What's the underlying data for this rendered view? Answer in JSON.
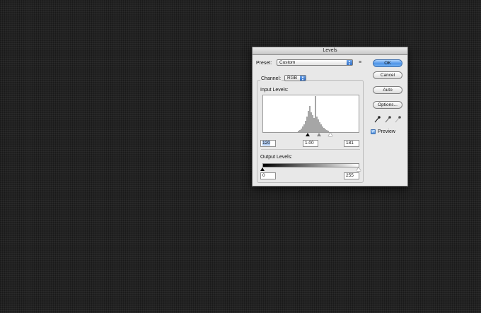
{
  "dialog": {
    "title": "Levels",
    "preset": {
      "label": "Preset:",
      "value": "Custom"
    },
    "channel": {
      "label": "Channel:",
      "value": "RGB"
    },
    "input_levels": {
      "label": "Input Levels:",
      "black": "120",
      "gamma": "1.00",
      "white": "181"
    },
    "output_levels": {
      "label": "Output Levels:",
      "black": "0",
      "white": "255"
    },
    "buttons": {
      "ok": "OK",
      "cancel": "Cancel",
      "auto": "Auto",
      "options": "Options..."
    },
    "preview": {
      "label": "Preview",
      "checked": true
    },
    "icons": [
      "presets-menu-icon",
      "black-eyedropper-icon",
      "gray-eyedropper-icon",
      "white-eyedropper-icon"
    ],
    "colors": {
      "default_button": "#4e95e8",
      "background": "#222222"
    }
  }
}
